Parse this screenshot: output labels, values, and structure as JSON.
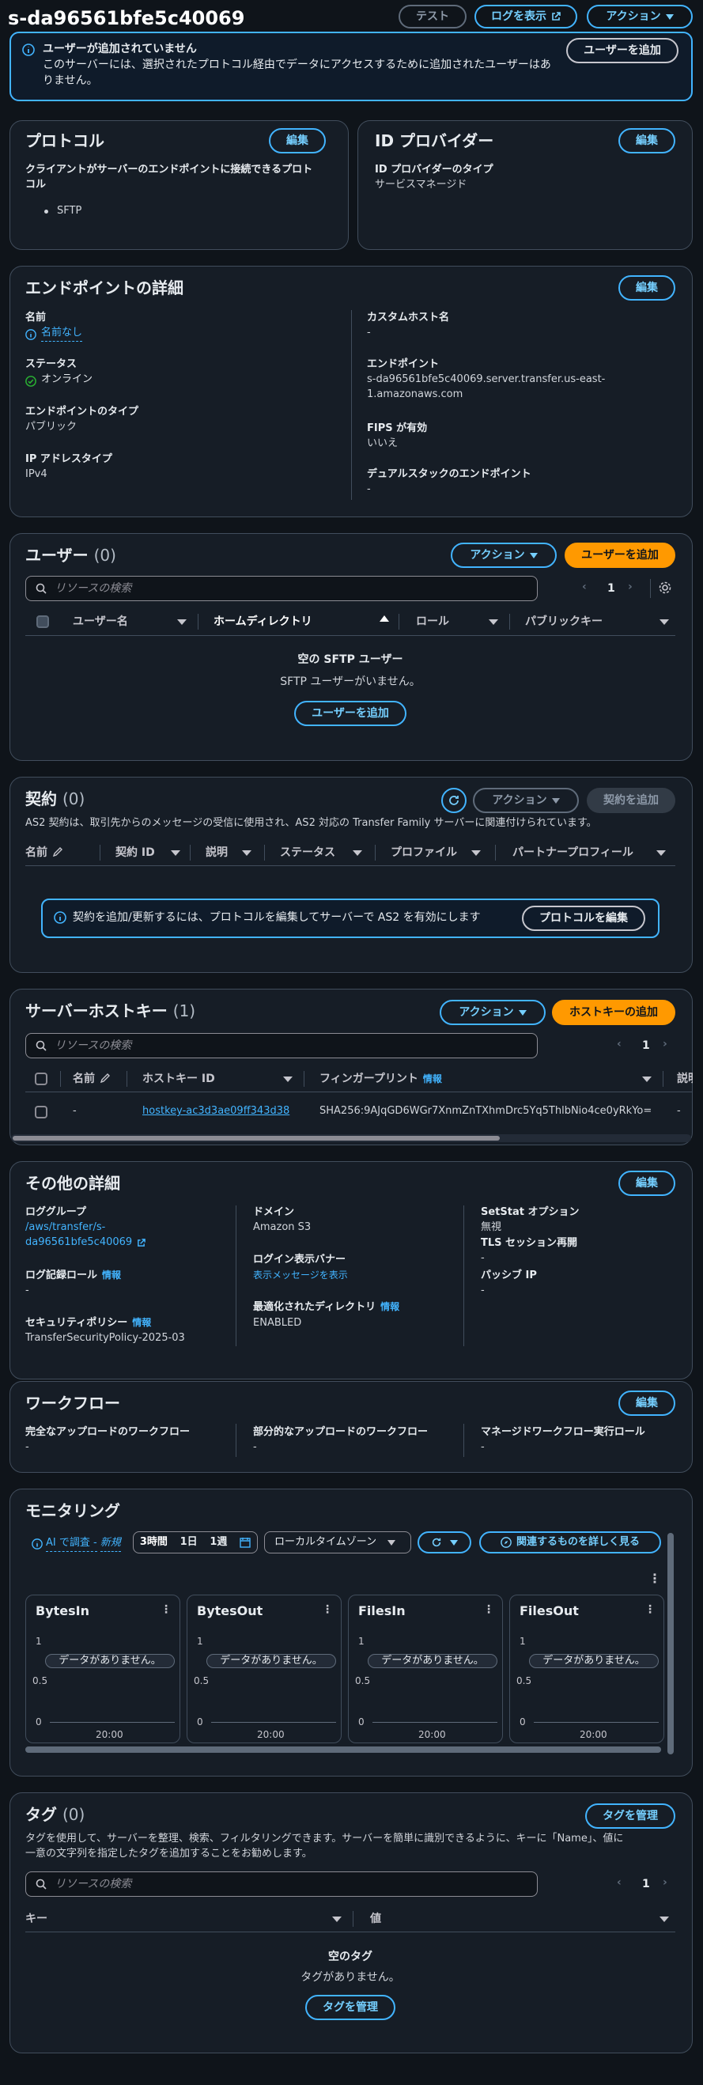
{
  "header": {
    "title": "s-da96561bfe5c40069",
    "test_label": "テスト",
    "logs_label": "ログを表示",
    "actions_label": "アクション"
  },
  "alert": {
    "title": "ユーザーが追加されていません",
    "body_line1": "このサーバーには、選択されたプロトコル経由でデータにアクセスするために追加されたユーザーはあ",
    "body_line2": "りません。",
    "button": "ユーザーを追加"
  },
  "protocol": {
    "title": "プロトコル",
    "edit": "編集",
    "label_line1": "クライアントがサーバーのエンドポイントに接続できるプロト",
    "label_line2": "コル",
    "item": "SFTP"
  },
  "idp": {
    "title": "ID プロバイダー",
    "edit": "編集",
    "label": "ID プロバイダーのタイプ",
    "value": "サービスマネージド"
  },
  "endpoint": {
    "title": "エンドポイントの詳細",
    "edit": "編集",
    "name_label": "名前",
    "name_value": "名前なし",
    "status_label": "ステータス",
    "status_value": "オンライン",
    "type_label": "エンドポイントのタイプ",
    "type_value": "パブリック",
    "ip_label": "IP アドレスタイプ",
    "ip_value": "IPv4",
    "custom_host_label": "カスタムホスト名",
    "custom_host_value": "-",
    "ep_label": "エンドポイント",
    "ep_value_line1": "s-da96561bfe5c40069.server.transfer.us-east-",
    "ep_value_line2": "1.amazonaws.com",
    "fips_label": "FIPS が有効",
    "fips_value": "いいえ",
    "dual_label": "デュアルスタックのエンドポイント",
    "dual_value": "-"
  },
  "users": {
    "title": "ユーザー",
    "count": "(0)",
    "actions": "アクション",
    "add": "ユーザーを追加",
    "search_placeholder": "リソースの検索",
    "page": "1",
    "columns": [
      "ユーザー名",
      "ホームディレクトリ",
      "ロール",
      "パブリックキー"
    ],
    "empty_title": "空の SFTP ユーザー",
    "empty_body": "SFTP ユーザーがいません。",
    "empty_button": "ユーザーを追加"
  },
  "agreements": {
    "title": "契約",
    "count": "(0)",
    "actions": "アクション",
    "add": "契約を追加",
    "description": "AS2 契約は、取引先からのメッセージの受信に使用され、AS2 対応の Transfer Family サーバーに関連付けられています。",
    "columns": [
      "名前",
      "契約 ID",
      "説明",
      "ステータス",
      "プロファイル",
      "パートナープロフィール"
    ],
    "notice": "契約を追加/更新するには、プロトコルを編集してサーバーで AS2 を有効にします",
    "notice_button": "プロトコルを編集"
  },
  "hostkeys": {
    "title": "サーバーホストキー",
    "count": "(1)",
    "actions": "アクション",
    "add": "ホストキーの追加",
    "search_placeholder": "リソースの検索",
    "page": "1",
    "columns": [
      "名前",
      "ホストキー ID",
      "フィンガープリント",
      "情報",
      "説明"
    ],
    "row": {
      "name": "-",
      "id": "hostkey-ac3d3ae09ff343d38",
      "fingerprint": "SHA256:9AJqGD6WGr7XnmZnTXhmDrc5Yq5ThlbNio4ce0yRkYo=",
      "desc": "-"
    }
  },
  "other": {
    "title": "その他の詳細",
    "edit": "編集",
    "loggroup_label": "ロググループ",
    "loggroup_line1": "/aws/transfer/s-",
    "loggroup_line2": "da96561bfe5c40069",
    "logrole_label": "ログ記録ロール",
    "info": "情報",
    "logrole_value": "-",
    "secpol_label": "セキュリティポリシー",
    "secpol_value": "TransferSecurityPolicy-2025-03",
    "domain_label": "ドメイン",
    "domain_value": "Amazon S3",
    "banner_label": "ログイン表示バナー",
    "banner_value": "表示メッセージを表示",
    "optdir_label": "最適化されたディレクトリ",
    "optdir_value": "ENABLED",
    "setstat_label": "SetStat オプション",
    "setstat_value": "無視",
    "tls_label": "TLS セッション再開",
    "tls_value": "-",
    "passive_label": "パッシブ IP",
    "passive_value": "-"
  },
  "workflow": {
    "title": "ワークフロー",
    "edit": "編集",
    "full_label": "完全なアップロードのワークフロー",
    "full_value": "-",
    "partial_label": "部分的なアップロードのワークフロー",
    "partial_value": "-",
    "role_label": "マネージドワークフロー実行ロール",
    "role_value": "-"
  },
  "monitoring": {
    "title": "モニタリング",
    "ai_label": "AI で調査 -",
    "ai_new": "新規",
    "range_3h": "3時間",
    "range_1d": "1日",
    "range_1w": "1週",
    "timezone": "ローカルタイムゾーン",
    "related": "関連するものを詳しく見る",
    "no_data": "データがありません。",
    "y_top": "1",
    "y_mid": "0.5",
    "y_bottom": "0",
    "x_tick": "20:00",
    "charts": [
      "BytesIn",
      "BytesOut",
      "FilesIn",
      "FilesOut"
    ]
  },
  "tags": {
    "title": "タグ",
    "count": "(0)",
    "manage": "タグを管理",
    "desc_line1": "タグを使用して、サーバーを整理、検索、フィルタリングできます。サーバーを簡単に識別できるように、キーに「Name」、値に",
    "desc_line2": "一意の文字列を指定したタグを追加することをお勧めします。",
    "search_placeholder": "リソースの検索",
    "page": "1",
    "col_key": "キー",
    "col_value": "値",
    "empty_title": "空のタグ",
    "empty_body": "タグがありません。",
    "empty_button": "タグを管理"
  },
  "colors": {
    "accent": "#42b4ff",
    "primary": "#ff9900",
    "success": "#29ad32"
  }
}
